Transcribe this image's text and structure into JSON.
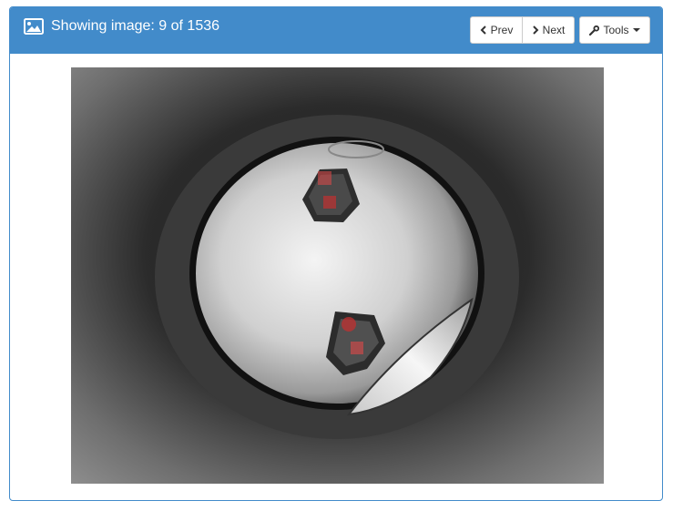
{
  "header": {
    "title": "Showing image: 9 of 1536",
    "icon": "image-icon"
  },
  "toolbar": {
    "prev_label": "Prev",
    "next_label": "Next",
    "tools_label": "Tools"
  },
  "colors": {
    "panel_primary": "#428bca",
    "marker_red": "#e04848"
  },
  "image": {
    "description_icon": "microscope-image"
  }
}
